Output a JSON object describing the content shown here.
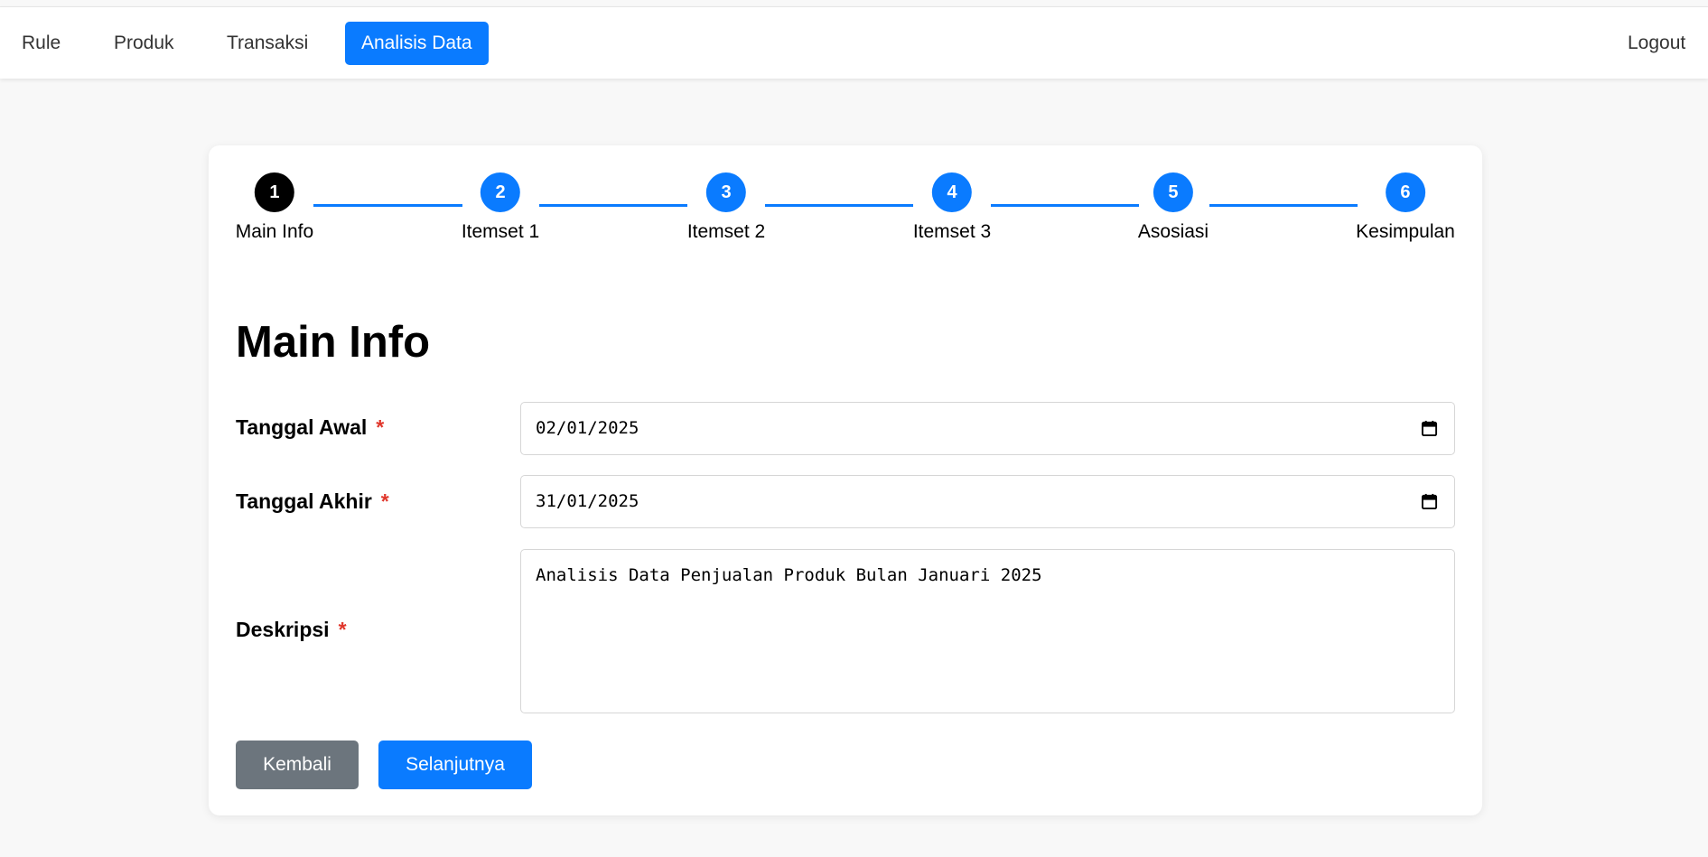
{
  "nav": {
    "items": [
      {
        "label": "Rule",
        "active": false
      },
      {
        "label": "Produk",
        "active": false
      },
      {
        "label": "Transaksi",
        "active": false
      },
      {
        "label": "Analisis Data",
        "active": true
      }
    ],
    "logout_label": "Logout",
    "accent_color": "#0a7bff"
  },
  "stepper": {
    "current_step": 1,
    "steps": [
      {
        "number": "1",
        "label": "Main Info"
      },
      {
        "number": "2",
        "label": "Itemset 1"
      },
      {
        "number": "3",
        "label": "Itemset 2"
      },
      {
        "number": "4",
        "label": "Itemset 3"
      },
      {
        "number": "5",
        "label": "Asosiasi"
      },
      {
        "number": "6",
        "label": "Kesimpulan"
      }
    ]
  },
  "form": {
    "title": "Main Info",
    "required_marker": "*",
    "tanggal_awal": {
      "label": "Tanggal Awal",
      "value": "02/01/2025"
    },
    "tanggal_akhir": {
      "label": "Tanggal Akhir",
      "value": "31/01/2025"
    },
    "deskripsi": {
      "label": "Deskripsi",
      "value": "Analisis Data Penjualan Produk Bulan Januari 2025"
    }
  },
  "buttons": {
    "back_label": "Kembali",
    "next_label": "Selanjutnya"
  },
  "icons": {
    "date_picker": "calendar-icon"
  }
}
